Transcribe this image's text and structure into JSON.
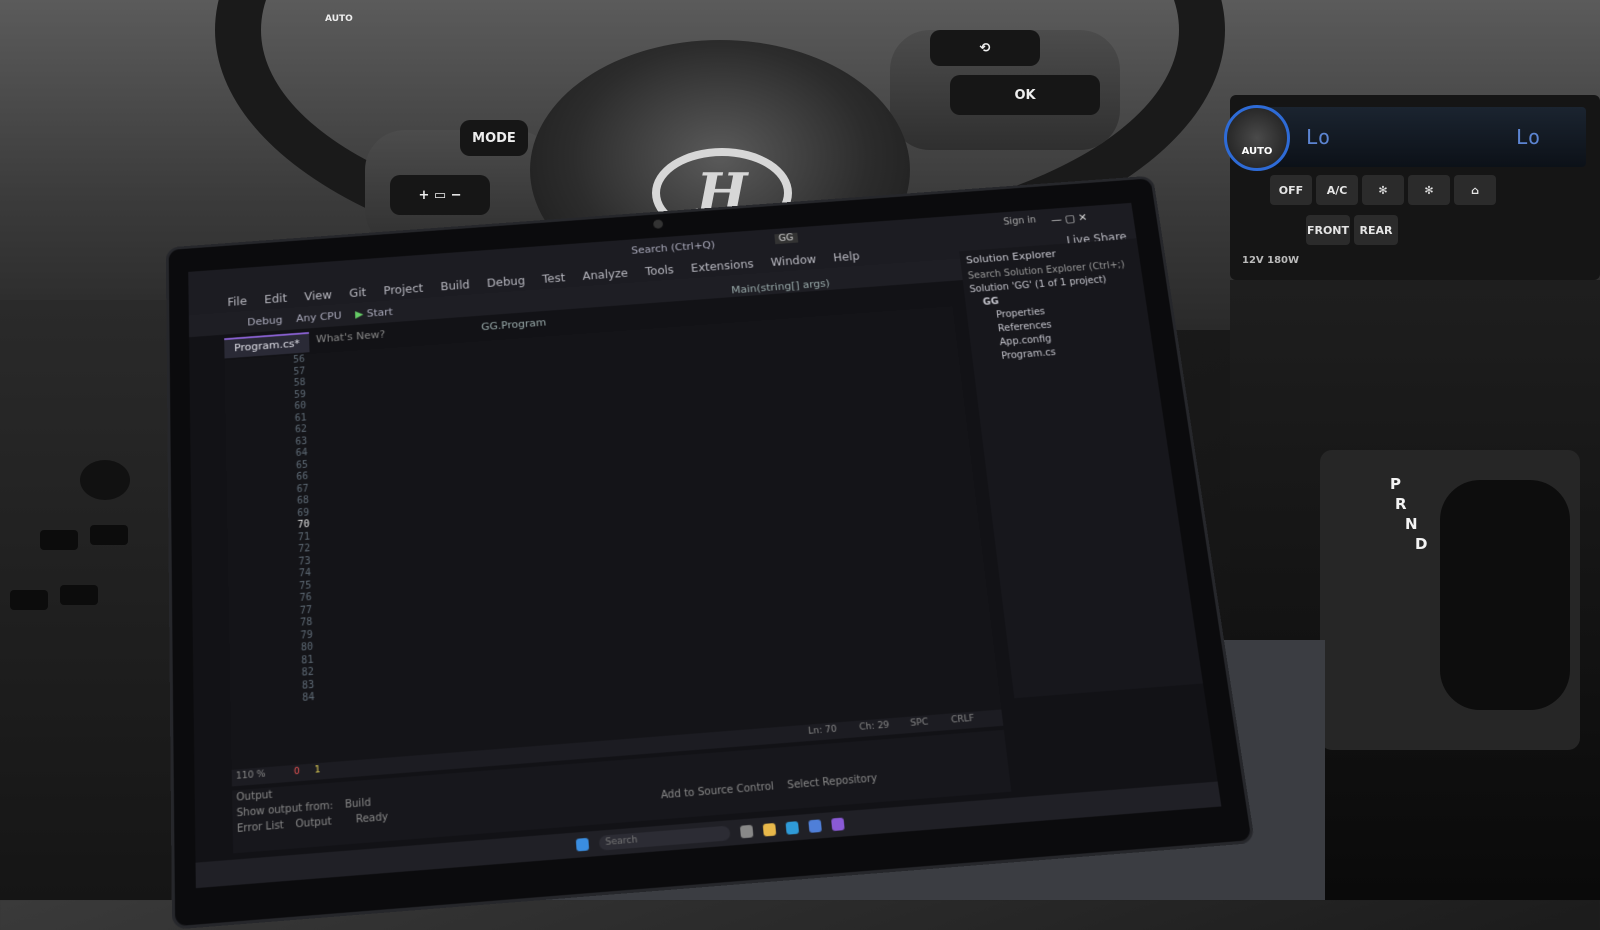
{
  "car": {
    "steering_buttons": {
      "mode": "MODE",
      "ok": "OK",
      "auto": "AUTO"
    },
    "climate": {
      "knob": "AUTO",
      "off": "OFF",
      "ac": "A/C",
      "lcd_left": "Lo",
      "lcd_right": "Lo",
      "front": "FRONT",
      "rear": "REAR",
      "usb": "12V 180W"
    },
    "gear_letters": [
      "P",
      "R",
      "N",
      "D"
    ]
  },
  "ide": {
    "search": "Search (Ctrl+Q)",
    "project_tag": "GG",
    "sign_in": "Sign in",
    "live_share": "Live Share",
    "menu": [
      "File",
      "Edit",
      "View",
      "Git",
      "Project",
      "Build",
      "Debug",
      "Test",
      "Analyze",
      "Tools",
      "Extensions",
      "Window",
      "Help"
    ],
    "toolbar": {
      "config": "Debug",
      "platform": "Any CPU",
      "start": "Start"
    },
    "tab": "Program.cs*",
    "whats_new": "What's New?",
    "nav_class": "GG.Program",
    "nav_method": "Main(string[] args)",
    "solution_explorer": {
      "title": "Solution Explorer",
      "search": "Search Solution Explorer (Ctrl+;)",
      "solution": "Solution 'GG' (1 of 1 project)",
      "items": [
        "GG",
        "Properties",
        "References",
        "App.config",
        "Program.cs"
      ]
    },
    "line_numbers": [
      "56",
      "57",
      "58",
      "59",
      "60",
      "61",
      "62",
      "63",
      "64",
      "65",
      "66",
      "67",
      "68",
      "69",
      "70",
      "71",
      "72",
      "73",
      "74",
      "75",
      "76",
      "77",
      "78",
      "79",
      "80",
      "81",
      "82",
      "83",
      "84"
    ],
    "current_line": "70",
    "status": {
      "zoom": "110 %",
      "errors": "0",
      "warnings": "1",
      "ln": "Ln: 70",
      "ch": "Ch: 29",
      "spc": "SPC",
      "crlf": "CRLF"
    },
    "output_title": "Output",
    "output_show": "Show output from:",
    "output_source": "Build",
    "bottom_tabs": [
      "Error List",
      "Output"
    ],
    "ready": "Ready",
    "add_source": "Add to Source Control",
    "select_repo": "Select Repository",
    "taskbar_search": "Search"
  }
}
